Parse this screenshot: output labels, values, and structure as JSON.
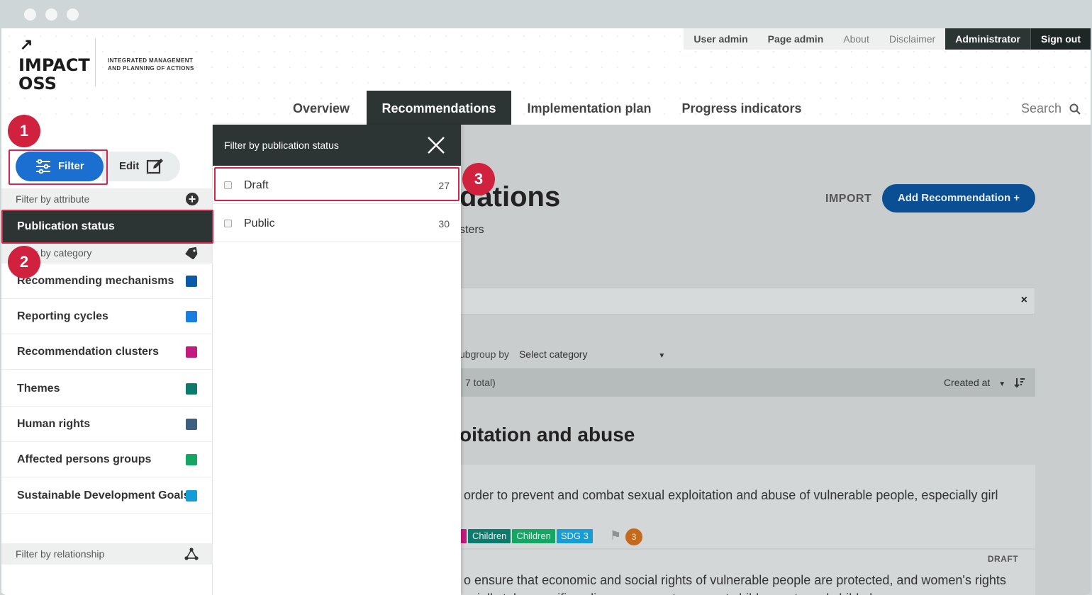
{
  "header": {
    "logo": {
      "line1": "IMPACT",
      "line2": "OSS",
      "arrow": "↗"
    },
    "tagline": "INTEGRATED MANAGEMENT AND PLANNING OF ACTIONS",
    "topnav": [
      "User admin",
      "Page admin",
      "About",
      "Disclaimer",
      "Administrator",
      "Sign out"
    ],
    "mainnav": [
      "Overview",
      "Recommendations",
      "Implementation plan",
      "Progress indicators"
    ],
    "search_label": "Search"
  },
  "sidebar": {
    "filter_label": "Filter",
    "edit_label": "Edit",
    "filter_by_attribute": "Filter by attribute",
    "publication_status": "Publication status",
    "filter_by_category": "Filter by category",
    "filter_by_relationship": "Filter by relationship",
    "categories": [
      {
        "label": "Recommending mechanisms",
        "color": "#0a5aa8"
      },
      {
        "label": "Reporting cycles",
        "color": "#1a7ee0"
      },
      {
        "label": "Recommendation clusters",
        "color": "#c21b7f"
      },
      {
        "label": "Themes",
        "color": "#0e7a6e"
      },
      {
        "label": "Human rights",
        "color": "#3d5e7e"
      },
      {
        "label": "Affected persons groups",
        "color": "#15a564"
      },
      {
        "label": "Sustainable Development Goals",
        "color": "#159ed6"
      }
    ]
  },
  "filter_panel": {
    "title": "Filter by publication status",
    "options": [
      {
        "label": "Draft",
        "count": "27"
      },
      {
        "label": "Public",
        "count": "30"
      }
    ]
  },
  "content": {
    "title_partial": "dations",
    "subtitle_partial": "sters",
    "import_label": "IMPORT",
    "add_label": "Add Recommendation +",
    "search_clear": "×",
    "subgroup_label": "ubgroup by",
    "subgroup_select": "Select category",
    "list_count_partial": "7 total)",
    "sort_label": "Created at",
    "group_title_partial": "oitation and abuse",
    "card1_text": "order to prevent and combat sexual exploitation and abuse of vulnerable people, especially girl",
    "card1_tags": [
      {
        "label": "Children",
        "color": "#0e7a6e"
      },
      {
        "label": "Children",
        "color": "#15a564"
      },
      {
        "label": "SDG 3",
        "color": "#159ed6"
      }
    ],
    "card1_badge": "3",
    "card2_status": "DRAFT",
    "card2_text_line1": "o ensure that economic and social rights of vulnerable people are protected, and women's rights",
    "card2_text_line2": "ecially take specific policy measures to prevent child poverty and child abuse"
  },
  "annotations": [
    "1",
    "2",
    "3"
  ],
  "colors": {
    "accent": "#1a6fd0",
    "dark": "#2c3434",
    "highlight": "#d6244a"
  }
}
